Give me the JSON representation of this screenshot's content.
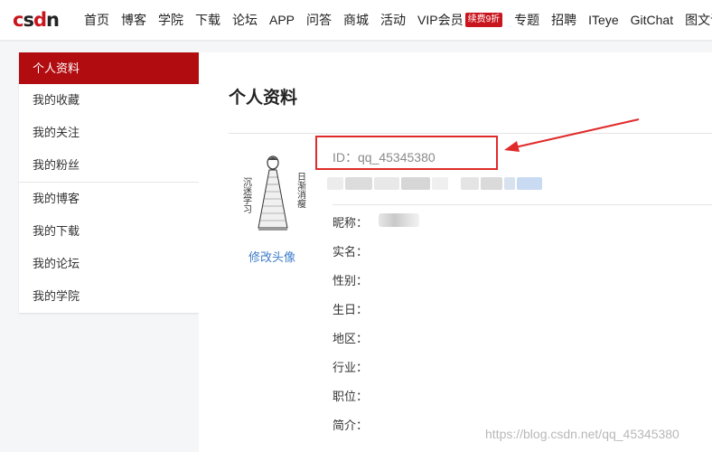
{
  "logo": {
    "letters": [
      {
        "char": "c",
        "color": "#c9151e"
      },
      {
        "char": "s",
        "color": "#222222"
      },
      {
        "char": "d",
        "color": "#c9151e"
      },
      {
        "char": "n",
        "color": "#222222"
      }
    ]
  },
  "nav": {
    "items": [
      "首页",
      "博客",
      "学院",
      "下载",
      "论坛",
      "APP",
      "问答",
      "商城",
      "活动"
    ],
    "vip_label": "VIP会员",
    "vip_badge": "续费9折",
    "items_after": [
      "专题",
      "招聘",
      "ITeye",
      "GitChat",
      "图文课"
    ]
  },
  "sidebar": {
    "group1": [
      "个人资料",
      "我的收藏",
      "我的关注",
      "我的粉丝"
    ],
    "group2": [
      "我的博客",
      "我的下载",
      "我的论坛",
      "我的学院"
    ],
    "active_index": 0
  },
  "main": {
    "title": "个人资料",
    "id_text": "ID：qq_45345380",
    "change_avatar": "修改头像",
    "avatar_text_left": "沉迷学习",
    "avatar_text_right": "日渐消瘦",
    "fields": [
      "昵称：",
      "实名：",
      "性别：",
      "生日：",
      "地区：",
      "行业：",
      "职位：",
      "简介："
    ]
  },
  "colors": {
    "brand_red": "#b10c10",
    "annotation_red": "#e02b2b",
    "link_blue": "#3d7cc9"
  },
  "watermark": "https://blog.csdn.net/qq_45345380"
}
